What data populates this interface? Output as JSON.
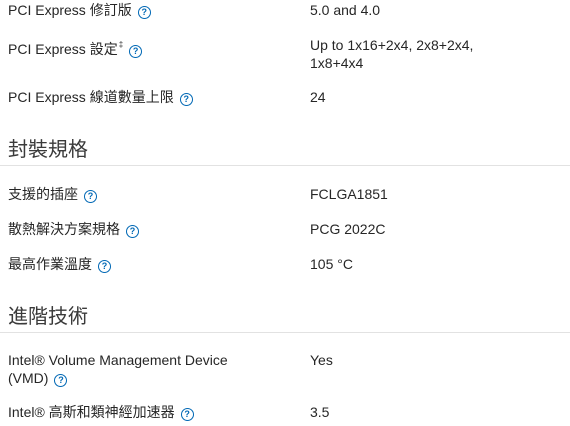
{
  "help_glyph": "?",
  "rows_top": [
    {
      "label": "PCI Express 修訂版",
      "value": "5.0 and 4.0"
    },
    {
      "label": "PCI Express 設定",
      "sup": "‡",
      "value_line1": "Up to 1x16+2x4, 2x8+2x4,",
      "value_line2": "1x8+4x4"
    },
    {
      "label": "PCI Express 線道數量上限",
      "value": "24"
    }
  ],
  "section_package": {
    "title": "封裝規格",
    "rows": [
      {
        "label": "支援的插座",
        "value": "FCLGA1851"
      },
      {
        "label": "散熱解決方案規格",
        "value": "PCG 2022C"
      },
      {
        "label": "最高作業溫度",
        "value": "105 °C"
      }
    ]
  },
  "section_advanced": {
    "title": "進階技術",
    "rows": [
      {
        "label_line1": "Intel® Volume Management Device",
        "label_line2": "(VMD)",
        "value": "Yes"
      },
      {
        "label": "Intel® 高斯和類神經加速器",
        "value": "3.5"
      }
    ]
  },
  "colors": {
    "help_icon": "#0068b5",
    "divider": "#e2e2e2",
    "text": "#262626"
  }
}
